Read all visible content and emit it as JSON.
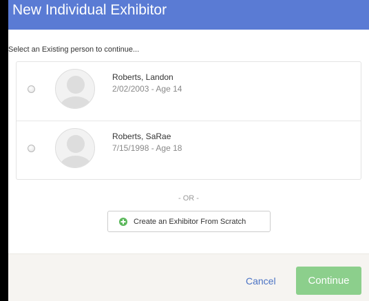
{
  "dialog": {
    "title": "New Individual Exhibitor",
    "prompt": "Select an Existing person to continue..."
  },
  "people": [
    {
      "name": "Roberts, Landon",
      "meta": "2/02/2003 - Age 14",
      "selected": false,
      "avatar_icon": "person-silhouette-icon"
    },
    {
      "name": "Roberts, SaRae",
      "meta": "7/15/1998 - Age 18",
      "selected": false,
      "avatar_icon": "person-silhouette-icon"
    }
  ],
  "divider": {
    "text": "- OR -"
  },
  "create": {
    "label": "Create an Exhibitor From Scratch",
    "icon": "plus-circle-icon",
    "icon_color": "#5cb85c"
  },
  "footer": {
    "cancel_label": "Cancel",
    "continue_label": "Continue",
    "continue_color": "#8ccf8c",
    "cancel_color": "#4a72c4"
  },
  "colors": {
    "header": "#5a7bd4",
    "footer_bg": "#f6f4f1"
  }
}
